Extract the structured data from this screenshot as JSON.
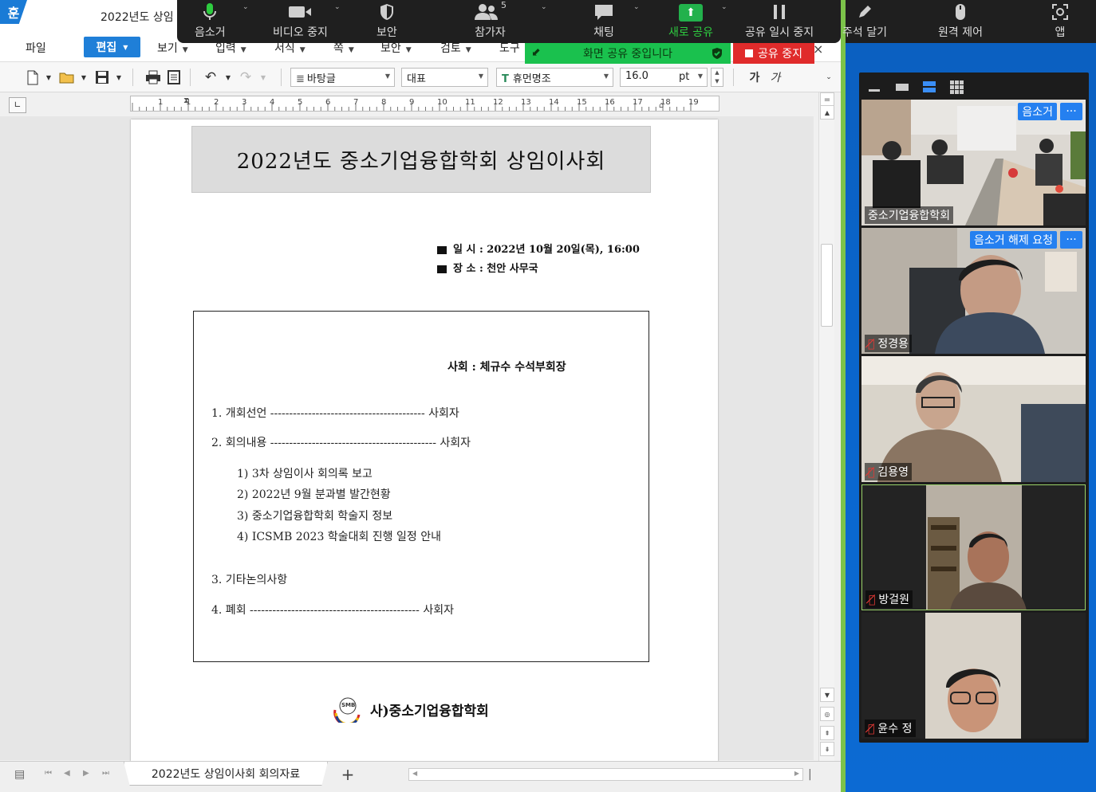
{
  "editor": {
    "logo": "훈",
    "window_title": "2022년도 상임",
    "menu": {
      "file": "파일",
      "edit": "편집",
      "view": "보기",
      "input": "입력",
      "format": "서식",
      "page": "쪽",
      "security": "보안",
      "review": "검토",
      "tools": "도구"
    },
    "toolbar": {
      "style": "바탕글",
      "style_lang": "대표",
      "font_icon": "T",
      "font": "휴먼명조",
      "size": "16.0",
      "unit": "pt",
      "bold": "가",
      "italic": "가"
    },
    "ruler_ticks": [
      "1",
      "1",
      "2",
      "3",
      "4",
      "5",
      "6",
      "7",
      "8",
      "9",
      "10",
      "11",
      "12",
      "13",
      "14",
      "15",
      "16",
      "17",
      "18",
      "19"
    ],
    "document": {
      "heading": "2022년도 중소기업융합학회 상임이사회",
      "date_line": "일 시 : 2022년 10월 20일(목), 16:00",
      "place_line": "장 소 : 천안 사무국",
      "chair": "사회 : 체규수 수석부회장",
      "agenda": [
        "1. 개회선언 ----------------------------------------- 사회자",
        "2. 회의내용 -------------------------------------------- 사회자",
        "3. 기타논의사항",
        "4. 폐회 --------------------------------------------- 사회자"
      ],
      "sub_items": [
        "1) 3차 상임이사 회의록 보고",
        "2) 2022년 9월 분과별 발간현황",
        "3) 중소기업융합학회 학술지 정보",
        "4) ICSMB 2023 학술대회 진행 일정 안내"
      ],
      "footer_logo_text": "SMB",
      "footer": "사)중소기업융합학회"
    },
    "sheet_tab": "2022년도 상임이사회 회의자료",
    "add_tab": "+"
  },
  "zoom": {
    "toolbar": {
      "mute": "음소거",
      "stop_video": "비디오 중지",
      "security": "보안",
      "participants": "참가자",
      "participants_count": "5",
      "chat": "채팅",
      "new_share": "새로 공유",
      "pause_share": "공유 일시 중지",
      "annotate_close": "주석 달기",
      "remote_control": "원격 제어",
      "apps": "앱"
    },
    "sharing_banner": "화면 공유 중입니다",
    "stop_share": "공유 중지",
    "close": "×",
    "participants": [
      {
        "name": "중소기업융합학회",
        "button": "음소거",
        "more": "···",
        "muted": false
      },
      {
        "name": "정경용",
        "button": "음소거 해제 요청",
        "more": "···",
        "muted": true
      },
      {
        "name": "김용영",
        "muted": true
      },
      {
        "name": "방걸원",
        "muted": true
      },
      {
        "name": "윤수 정",
        "muted": true
      }
    ],
    "accent_green": "#1ac14e",
    "accent_red": "#e02b2b",
    "accent_blue": "#2580f0"
  }
}
